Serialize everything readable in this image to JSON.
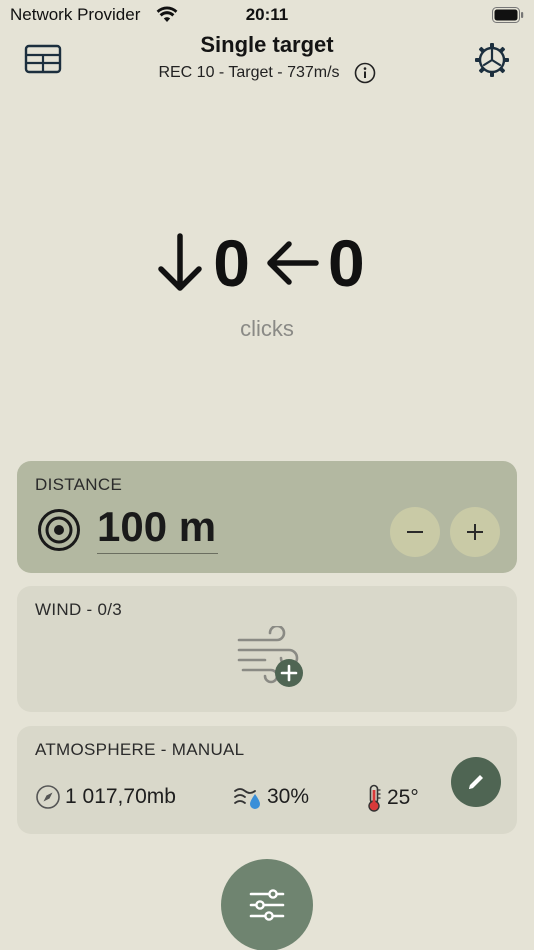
{
  "status_bar": {
    "carrier": "Network Provider",
    "time": "20:11"
  },
  "header": {
    "title": "Single target",
    "subtitle": "REC 10 - Target - 737m/s"
  },
  "readout": {
    "vertical_value": "0",
    "horizontal_value": "0",
    "unit_label": "clicks"
  },
  "distance": {
    "label": "DISTANCE",
    "value": "100 m"
  },
  "wind": {
    "label": "WIND - 0/3"
  },
  "atmosphere": {
    "label": "ATMOSPHERE - MANUAL",
    "pressure": "1 017,70mb",
    "humidity": "30%",
    "temperature": "25°"
  },
  "icons": {
    "grid": "table-grid-icon",
    "info": "info-icon",
    "settings": "gear-icon",
    "down_arrow": "arrow-down-icon",
    "left_arrow": "arrow-left-icon",
    "target": "target-icon",
    "minus": "minus-icon",
    "plus": "plus-icon",
    "wind_add": "wind-add-icon",
    "compass": "compass-icon",
    "humidity": "humidity-icon",
    "thermometer": "thermometer-icon",
    "edit": "pencil-icon",
    "sliders": "sliders-icon"
  },
  "colors": {
    "background": "#e5e3d6",
    "distance_card": "#b3b8a1",
    "card": "#d9d8ca",
    "accent_green": "#4f6553",
    "fab": "#6f8470",
    "stepper_button": "#c9caa6"
  }
}
